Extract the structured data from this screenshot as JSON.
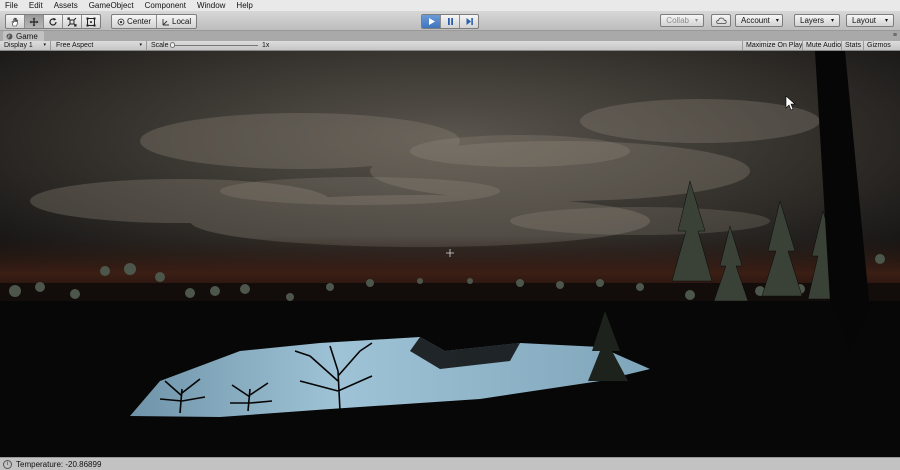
{
  "menu": [
    "File",
    "Edit",
    "Assets",
    "GameObject",
    "Component",
    "Window",
    "Help"
  ],
  "toolbar": {
    "tools": [
      "hand-tool-icon",
      "move-tool-icon",
      "rotate-tool-icon",
      "scale-tool-icon",
      "rect-tool-icon"
    ],
    "pivot_label": "Center",
    "space_label": "Local",
    "play_state": "playing",
    "collab_label": "Collab",
    "account_label": "Account",
    "layers_label": "Layers",
    "layout_label": "Layout"
  },
  "tab": {
    "title": "Game"
  },
  "game_view": {
    "display": "Display 1",
    "aspect": "Free Aspect",
    "scale_label": "Scale",
    "scale_value": "1x",
    "maximize_label": "Maximize On Play",
    "mute_label": "Mute Audio",
    "stats_label": "Stats",
    "gizmos_label": "Gizmos"
  },
  "status": {
    "text": "Temperature: -20.86899"
  },
  "colors": {
    "play_accent": "#3f74be",
    "sky": "#4a4640",
    "water": "#8fb4c8"
  }
}
